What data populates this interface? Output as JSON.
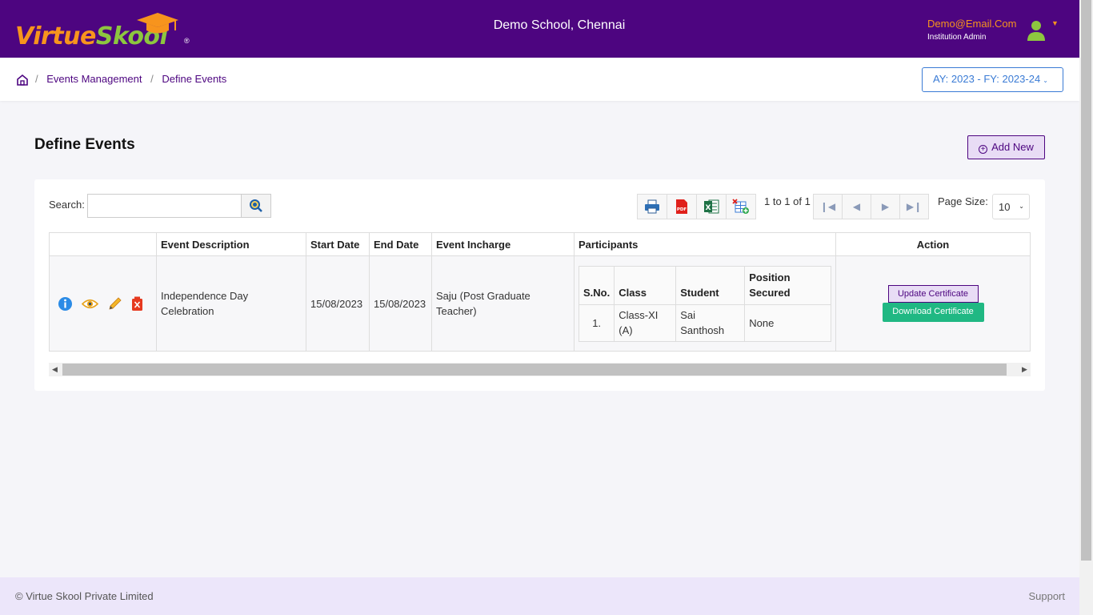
{
  "header": {
    "logo_virtue": "Virtue",
    "logo_skool": "Skool",
    "logo_reg": "®",
    "school_name": "Demo School, Chennai",
    "user_email": "Demo@Email.Com",
    "user_role": "Institution Admin"
  },
  "breadcrumb": {
    "items": [
      "Events Management",
      "Define Events"
    ],
    "separator": "/"
  },
  "year_selector": {
    "value": "AY: 2023 - FY: 2023-24"
  },
  "page": {
    "title": "Define Events",
    "add_button": "Add New"
  },
  "toolbar": {
    "search_label": "Search:",
    "search_value": "",
    "pager_text": "1 to 1 of 1",
    "page_size_label": "Page Size:",
    "page_size_value": "10"
  },
  "table": {
    "columns": [
      "",
      "Event Description",
      "Start Date",
      "End Date",
      "Event Incharge",
      "Participants",
      "Action"
    ],
    "rows": [
      {
        "description": "Independence Day Celebration",
        "start_date": "15/08/2023",
        "end_date": "15/08/2023",
        "incharge": "Saju (Post Graduate Teacher)",
        "participants": {
          "columns": [
            "S.No.",
            "Class",
            "Student",
            "Position Secured"
          ],
          "rows": [
            {
              "sno": "1.",
              "class": "Class-XI (A)",
              "student": "Sai Santhosh",
              "position": "None"
            }
          ]
        },
        "actions": {
          "update": "Update Certificate",
          "download": "Download Certificate"
        }
      }
    ]
  },
  "footer": {
    "copyright": "© Virtue Skool Private Limited",
    "support": "Support"
  },
  "colors": {
    "brand_purple": "#4d0580",
    "brand_orange": "#f7941d",
    "brand_green": "#8dc63f",
    "download_green": "#20b883",
    "link_blue": "#3a7bd5"
  },
  "icons": [
    "graduation-cap-icon",
    "user-avatar-icon",
    "home-icon",
    "plus-circle-icon",
    "search-icon",
    "print-icon",
    "pdf-icon",
    "excel-icon",
    "column-settings-icon",
    "first-page-icon",
    "prev-page-icon",
    "next-page-icon",
    "last-page-icon",
    "info-icon",
    "view-icon",
    "edit-icon",
    "delete-icon"
  ]
}
